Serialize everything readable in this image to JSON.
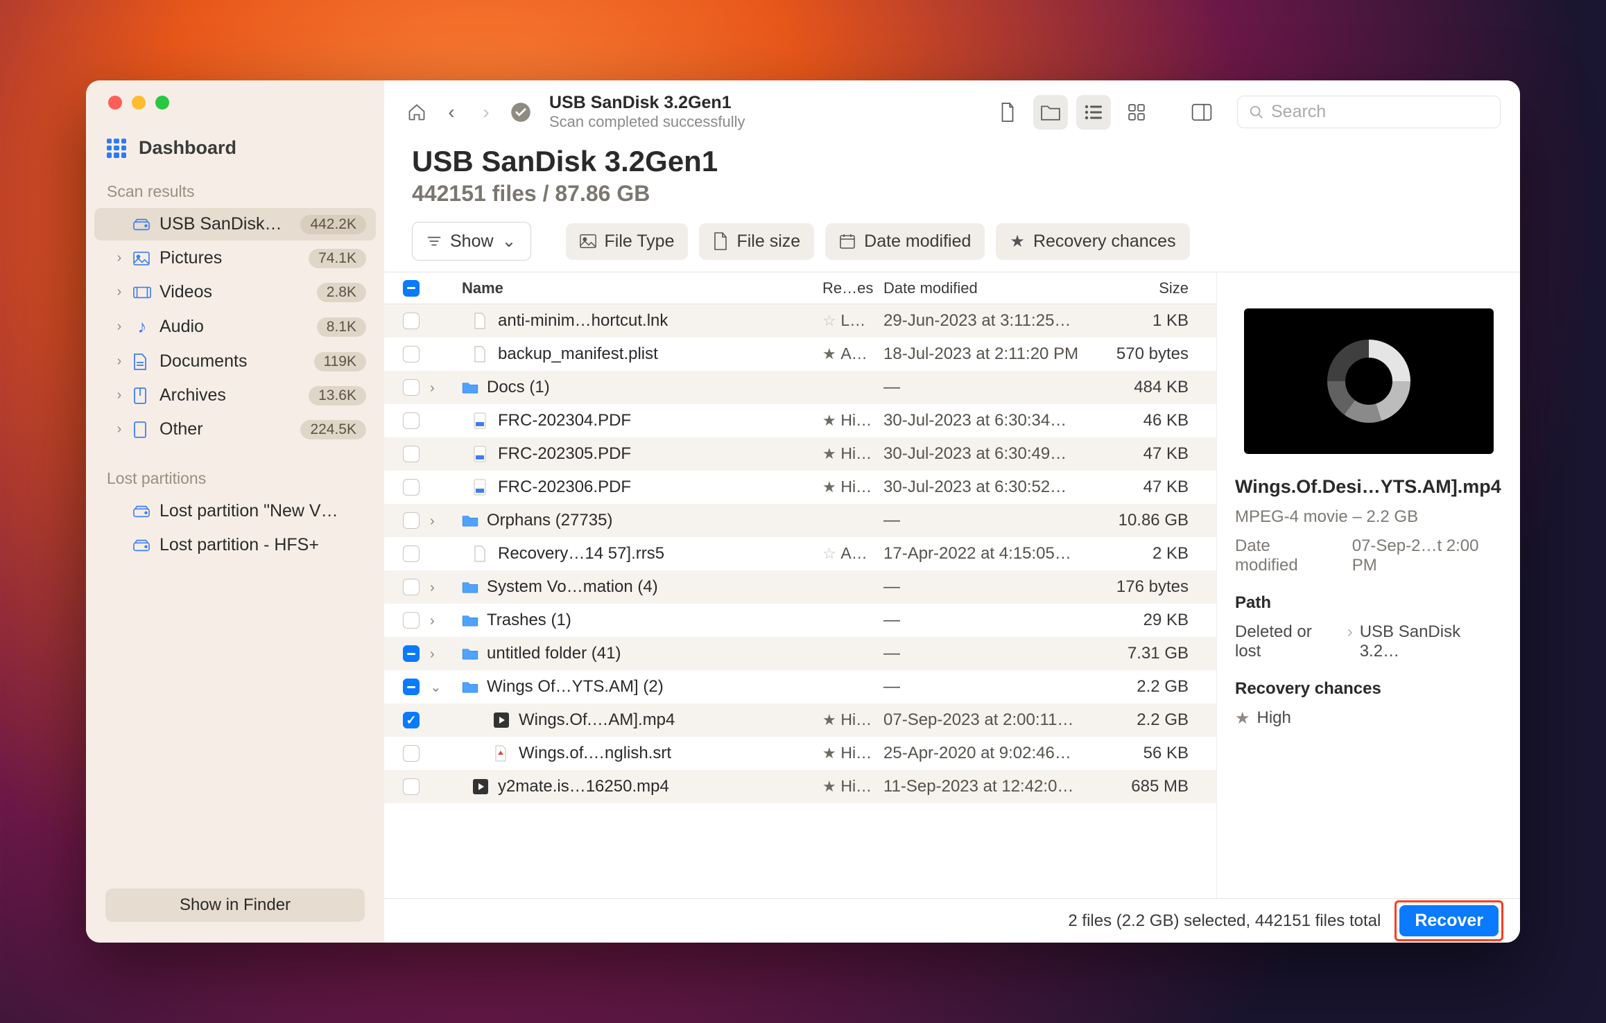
{
  "sidebar": {
    "dashboard": "Dashboard",
    "scan_results_label": "Scan results",
    "items": [
      {
        "icon": "drive",
        "label": "USB  SanDisk…",
        "badge": "442.2K",
        "active": true,
        "expandable": false
      },
      {
        "icon": "image",
        "label": "Pictures",
        "badge": "74.1K",
        "expandable": true
      },
      {
        "icon": "video",
        "label": "Videos",
        "badge": "2.8K",
        "expandable": true
      },
      {
        "icon": "audio",
        "label": "Audio",
        "badge": "8.1K",
        "expandable": true
      },
      {
        "icon": "doc",
        "label": "Documents",
        "badge": "119K",
        "expandable": true
      },
      {
        "icon": "arch",
        "label": "Archives",
        "badge": "13.6K",
        "expandable": true
      },
      {
        "icon": "other",
        "label": "Other",
        "badge": "224.5K",
        "expandable": true
      }
    ],
    "lost_label": "Lost partitions",
    "lost": [
      {
        "label": "Lost partition \"New V…"
      },
      {
        "label": "Lost partition - HFS+"
      }
    ],
    "show_finder": "Show in Finder"
  },
  "toolbar": {
    "title": "USB  SanDisk 3.2Gen1",
    "subtitle": "Scan completed successfully",
    "search_placeholder": "Search"
  },
  "header": {
    "title": "USB  SanDisk 3.2Gen1",
    "subtitle": "442151 files / 87.86 GB"
  },
  "filters": {
    "show": "Show",
    "file_type": "File Type",
    "file_size": "File size",
    "date_modified": "Date modified",
    "recovery": "Recovery chances"
  },
  "columns": {
    "name": "Name",
    "rec": "Re…es",
    "date": "Date modified",
    "size": "Size"
  },
  "rows": [
    {
      "check": "",
      "indent": 1,
      "icon": "file",
      "name": "anti-minim…hortcut.lnk",
      "star": "outl",
      "rec": "L…",
      "date": "29-Jun-2023 at 3:11:25…",
      "size": "1 KB"
    },
    {
      "check": "",
      "indent": 1,
      "icon": "file",
      "name": "backup_manifest.plist",
      "star": "fill",
      "rec": "A…",
      "date": "18-Jul-2023 at 2:11:20 PM",
      "size": "570 bytes"
    },
    {
      "check": "",
      "indent": 0,
      "discl": ">",
      "icon": "folder",
      "name": "Docs (1)",
      "date": "—",
      "size": "484 KB"
    },
    {
      "check": "",
      "indent": 1,
      "icon": "pdf",
      "name": "FRC-202304.PDF",
      "star": "fill",
      "rec": "Hi…",
      "date": "30-Jul-2023 at 6:30:34…",
      "size": "46 KB"
    },
    {
      "check": "",
      "indent": 1,
      "icon": "pdf",
      "name": "FRC-202305.PDF",
      "star": "fill",
      "rec": "Hi…",
      "date": "30-Jul-2023 at 6:30:49…",
      "size": "47 KB"
    },
    {
      "check": "",
      "indent": 1,
      "icon": "pdf",
      "name": "FRC-202306.PDF",
      "star": "fill",
      "rec": "Hi…",
      "date": "30-Jul-2023 at 6:30:52…",
      "size": "47 KB"
    },
    {
      "check": "",
      "indent": 0,
      "discl": ">",
      "icon": "folder",
      "name": "Orphans (27735)",
      "date": "—",
      "size": "10.86 GB"
    },
    {
      "check": "",
      "indent": 1,
      "icon": "file",
      "name": "Recovery…14 57].rrs5",
      "star": "outl",
      "rec": "A…",
      "date": "17-Apr-2022 at 4:15:05…",
      "size": "2 KB"
    },
    {
      "check": "",
      "indent": 0,
      "discl": ">",
      "icon": "folder",
      "name": "System Vo…mation (4)",
      "date": "—",
      "size": "176 bytes"
    },
    {
      "check": "",
      "indent": 0,
      "discl": ">",
      "icon": "folder",
      "name": "Trashes (1)",
      "date": "—",
      "size": "29 KB"
    },
    {
      "check": "part",
      "indent": 0,
      "discl": ">",
      "icon": "folder",
      "name": "untitled folder (41)",
      "date": "—",
      "size": "7.31 GB"
    },
    {
      "check": "part",
      "indent": 0,
      "discl": "v",
      "icon": "folder",
      "name": "Wings Of…YTS.AM] (2)",
      "date": "—",
      "size": "2.2 GB"
    },
    {
      "check": "on",
      "indent": 2,
      "icon": "vid",
      "name": "Wings.Of.…AM].mp4",
      "star": "fill",
      "rec": "Hi…",
      "date": "07-Sep-2023 at 2:00:11…",
      "size": "2.2 GB"
    },
    {
      "check": "",
      "indent": 2,
      "icon": "srt",
      "name": "Wings.of.…nglish.srt",
      "star": "fill",
      "rec": "Hi…",
      "date": "25-Apr-2020 at 9:02:46…",
      "size": "56 KB"
    },
    {
      "check": "",
      "indent": 1,
      "icon": "vid",
      "name": "y2mate.is…16250.mp4",
      "star": "fill",
      "rec": "Hi…",
      "date": "11-Sep-2023 at 12:42:0…",
      "size": "685 MB"
    }
  ],
  "details": {
    "title": "Wings.Of.Desi…YTS.AM].mp4",
    "kind": "MPEG-4 movie – 2.2 GB",
    "date_label": "Date modified",
    "date": "07-Sep-2…t 2:00 PM",
    "path_label": "Path",
    "path_a": "Deleted or lost",
    "path_b": "USB  SanDisk 3.2…",
    "rec_label": "Recovery chances",
    "rec_value": "High"
  },
  "footer": {
    "status": "2 files (2.2 GB) selected, 442151 files total",
    "recover": "Recover"
  }
}
